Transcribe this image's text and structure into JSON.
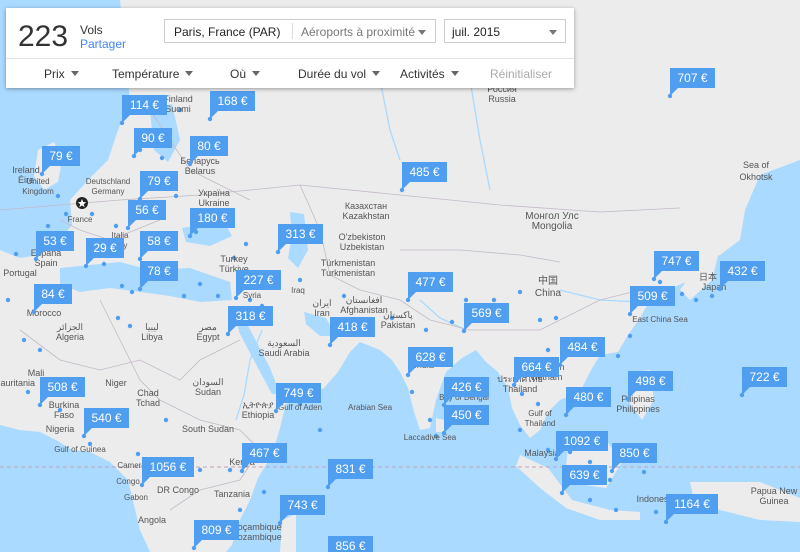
{
  "header": {
    "count": "223",
    "vols_label": "Vols",
    "share_label": "Partager"
  },
  "origin": {
    "city": "Paris, France (PAR)",
    "nearby_placeholder": "Aéroports à proximité"
  },
  "month": {
    "value": "juil. 2015"
  },
  "filters": [
    "Prix",
    "Température",
    "Où",
    "Durée du vol",
    "Activités"
  ],
  "reset_label": "Réinitialiser",
  "colors": {
    "pin": "#4f9ef0",
    "pin_text": "#ffffff",
    "ocean": "#aadaff",
    "land": "#ececec",
    "accent": "#4285f4"
  },
  "prices": [
    "707 €",
    "114 €",
    "168 €",
    "90 €",
    "79 €",
    "80 €",
    "79 €",
    "485 €",
    "56 €",
    "180 €",
    "313 €",
    "53 €",
    "29 €",
    "58 €",
    "78 €",
    "227 €",
    "477 €",
    "747 €",
    "432 €",
    "84 €",
    "509 €",
    "318 €",
    "418 €",
    "569 €",
    "628 €",
    "484 €",
    "664 €",
    "498 €",
    "722 €",
    "508 €",
    "749 €",
    "426 €",
    "480 €",
    "540 €",
    "450 €",
    "1092 €",
    "850 €",
    "467 €",
    "1056 €",
    "831 €",
    "639 €",
    "743 €",
    "1164 €",
    "809 €",
    "856 €"
  ],
  "map_labels": [
    "Finland",
    "Suomi",
    "Россия",
    "Russia",
    "Ireland",
    "Éire",
    "United",
    "Kingdom",
    "Belarus",
    "Беларусь",
    "Deutschland",
    "Germany",
    "France",
    "Україна",
    "Ukraine",
    "Казахстан",
    "Kazakhstan",
    "Монгол Улс",
    "Mongolia",
    "España",
    "Spain",
    "Portugal",
    "Italia",
    "Italy",
    "Türkiye",
    "Turkey",
    "O'zbekiston",
    "Uzbekistan",
    "Türkmenistan",
    "Turkmenistan",
    "中国",
    "China",
    "Sea of",
    "Okhotsk",
    "Morocco",
    "Algeria",
    "الجزائر",
    "Libya",
    "ليبيا",
    "Syria",
    "Iraq",
    "Iran",
    "ایران",
    "افغانستان",
    "Afghanistan",
    "پاکستان",
    "Pakistan",
    "Japan",
    "日本",
    "East China Sea",
    "Egypt",
    "مصر",
    "Saudi Arabia",
    "السعودية",
    "India",
    "भारत",
    "Mauritania",
    "Mali",
    "Niger",
    "Chad",
    "Tchad",
    "السودان",
    "Sudan",
    "Burkina",
    "Faso",
    "Nigeria",
    "Ethiopia",
    "ኢትዮጵያ",
    "South Sudan",
    "Gulf of Aden",
    "Arabian Sea",
    "Bay of Bengal",
    "Laccadive Sea",
    "Gulf of Guinea",
    "Kenya",
    "DR Congo",
    "Tanzania",
    "Angola",
    "Moçambique",
    "Mozambique",
    "Cameroon",
    "Gabon",
    "Congo",
    "Vietnam",
    "Việt Nam",
    "Thailand",
    "ประเทศไทย",
    "Philippines",
    "Pilipinas",
    "Malaysia",
    "Indonesia",
    "Papua New",
    "Guinea",
    "Gulf of",
    "Thailand"
  ]
}
